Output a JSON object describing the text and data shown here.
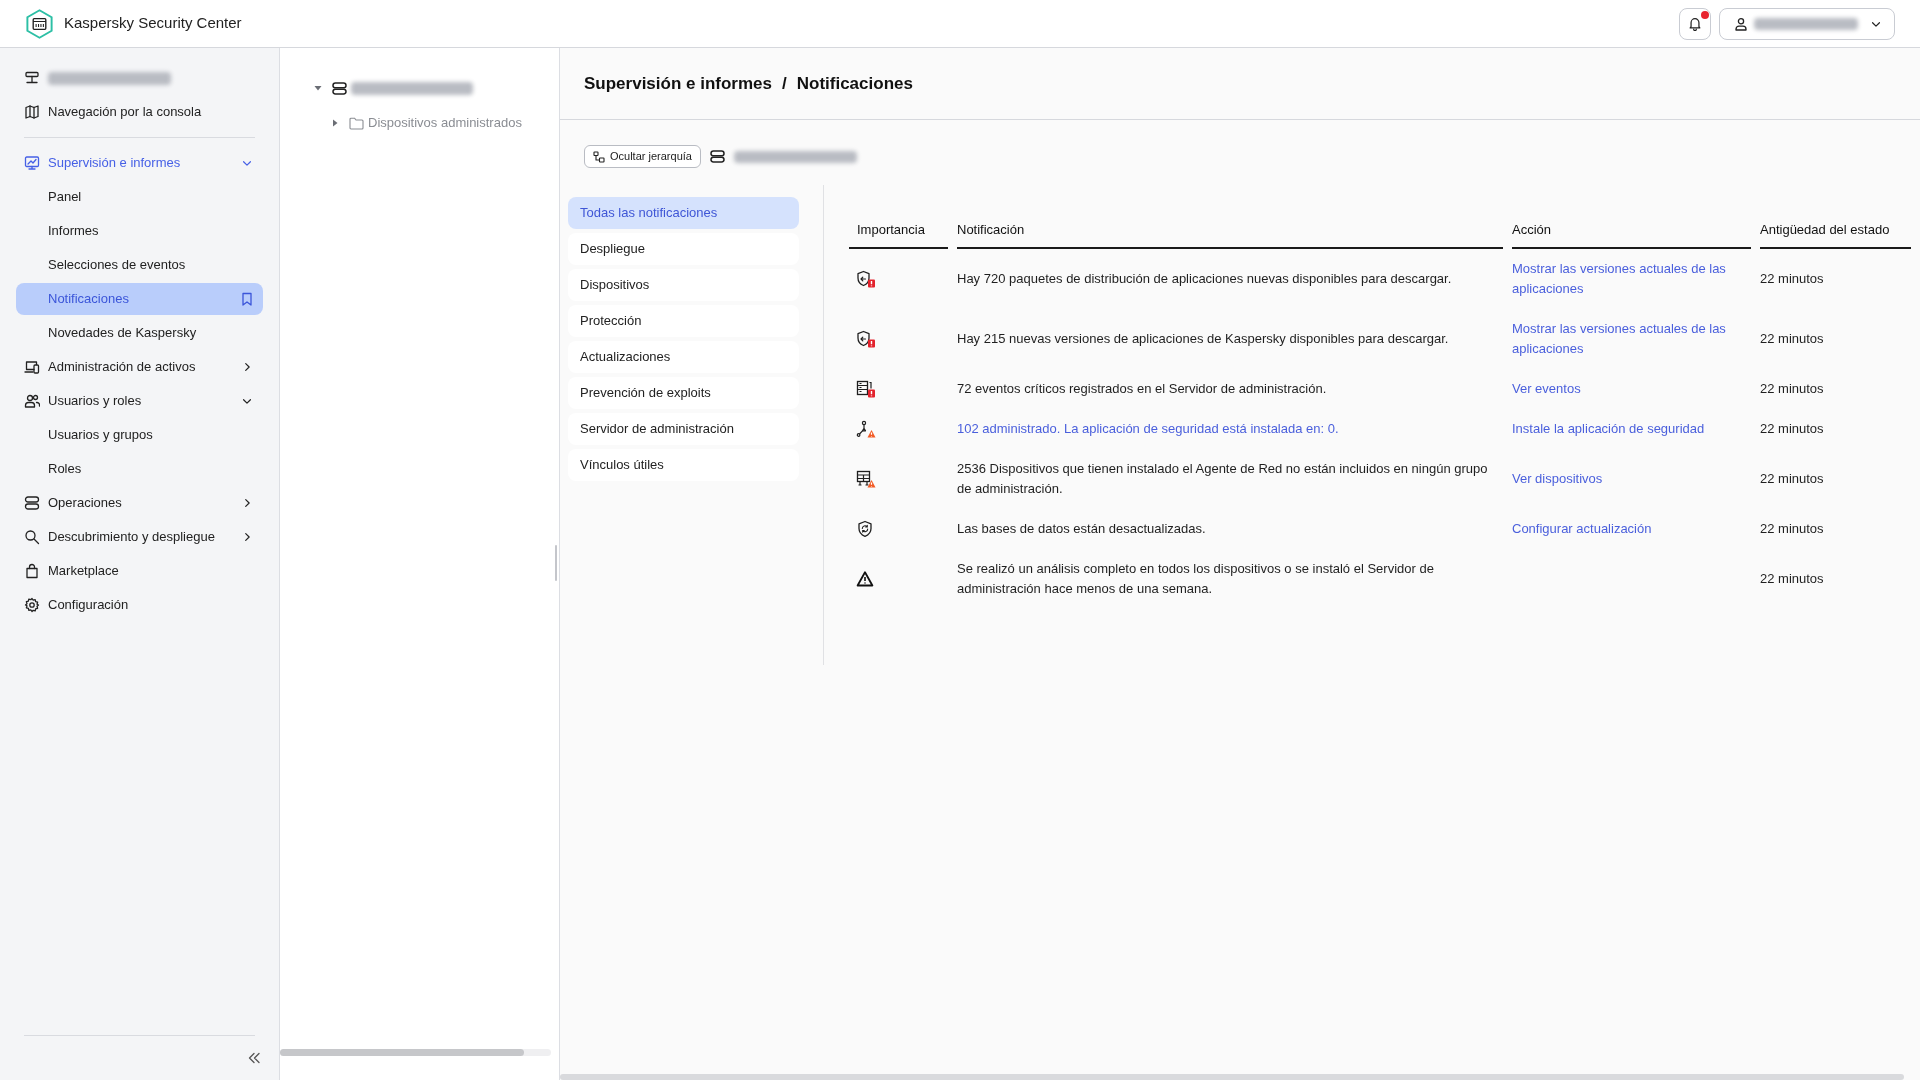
{
  "header": {
    "title": "Kaspersky Security Center",
    "notifications": {
      "unread": true
    },
    "user": {
      "redacted": true
    }
  },
  "sidebar": {
    "top_items": [
      {
        "kind": "server",
        "redacted": true,
        "selected": false
      },
      {
        "kind": "map",
        "label": "Navegación por la consola",
        "selected": false
      }
    ],
    "items": [
      {
        "kind": "monitoring",
        "label": "Supervisión e informes",
        "selected": false,
        "expanded": true,
        "children": [
          {
            "label": "Panel",
            "selected": false
          },
          {
            "label": "Informes",
            "selected": false
          },
          {
            "label": "Selecciones de eventos",
            "selected": false
          },
          {
            "label": "Notificaciones",
            "selected": true
          },
          {
            "label": "Novedades de Kaspersky",
            "selected": false
          }
        ]
      },
      {
        "kind": "assets",
        "label": "Administración de activos",
        "selected": false,
        "expanded": false
      },
      {
        "kind": "users",
        "label": "Usuarios y roles",
        "selected": false,
        "expanded": true,
        "children": [
          {
            "label": "Usuarios y grupos",
            "selected": false
          },
          {
            "label": "Roles",
            "selected": false
          }
        ]
      },
      {
        "kind": "operations",
        "label": "Operaciones",
        "selected": false,
        "expanded": false
      },
      {
        "kind": "discovery",
        "label": "Descubrimiento y despliegue",
        "selected": false,
        "expanded": false
      },
      {
        "kind": "marketplace",
        "label": "Marketplace",
        "selected": false
      },
      {
        "kind": "settings",
        "label": "Configuración",
        "selected": false
      }
    ]
  },
  "tree": {
    "nodes": [
      {
        "kind": "server",
        "redacted": true,
        "expanded": true,
        "selected": false,
        "children": [
          {
            "kind": "folder",
            "label": "Dispositivos administrados",
            "expanded": false,
            "selected": false
          }
        ]
      }
    ]
  },
  "main": {
    "breadcrumb": [
      "Supervisión e informes",
      "Notificaciones"
    ],
    "separator": "/",
    "toolbar": {
      "button": "Ocultar jerarquía",
      "server": {
        "redacted": true
      }
    },
    "categories": [
      {
        "label": "Todas las notificaciones",
        "selected": true
      },
      {
        "label": "Despliegue",
        "selected": false
      },
      {
        "label": "Dispositivos",
        "selected": false
      },
      {
        "label": "Protección",
        "selected": false
      },
      {
        "label": "Actualizaciones",
        "selected": false
      },
      {
        "label": "Prevención de exploits",
        "selected": false
      },
      {
        "label": "Servidor de administración",
        "selected": false
      },
      {
        "label": "Vínculos útiles",
        "selected": false
      }
    ],
    "table": {
      "columns": [
        "Importancia",
        "Notificación",
        "Acción",
        "Antigüedad del estado"
      ],
      "rows": [
        {
          "kind": "update",
          "critical": true,
          "warning": false,
          "notification": {
            "text": "Hay 720 paquetes de distribución de aplicaciones nuevas disponibles para descargar.",
            "link": false
          },
          "action": "Mostrar las versiones actuales de las aplicaciones",
          "age": "22 minutos"
        },
        {
          "kind": "update",
          "critical": true,
          "warning": false,
          "notification": {
            "text": "Hay 215 nuevas versiones de aplicaciones de Kaspersky disponibles para descargar.",
            "link": false
          },
          "action": "Mostrar las versiones actuales de las aplicaciones",
          "age": "22 minutos"
        },
        {
          "kind": "events",
          "critical": true,
          "warning": false,
          "notification": {
            "text": "72 eventos críticos registrados en el Servidor de administración.",
            "link": false
          },
          "action": "Ver eventos",
          "age": "22 minutos"
        },
        {
          "kind": "deployment",
          "critical": false,
          "warning": true,
          "notification": {
            "text": "102 administrado. La aplicación de seguridad está instalada en: 0.",
            "link": true
          },
          "action": "Instale la aplicación de seguridad",
          "age": "22 minutos"
        },
        {
          "kind": "devices",
          "critical": false,
          "warning": true,
          "notification": {
            "text": "2536 Dispositivos que tienen instalado el Agente de Red no están incluidos en ningún grupo de administración.",
            "link": false
          },
          "action": "Ver dispositivos",
          "age": "22 minutos"
        },
        {
          "kind": "databases",
          "critical": false,
          "warning": false,
          "notification": {
            "text": "Las bases de datos están desactualizadas.",
            "link": false
          },
          "action": "Configurar actualización",
          "age": "22 minutos"
        },
        {
          "kind": "scan",
          "critical": false,
          "warning": false,
          "notification": {
            "text": "Se realizó un análisis completo en todos los dispositivos o se instaló el Servidor de administración hace menos de una semana.",
            "link": false
          },
          "age": "22 minutos"
        }
      ]
    }
  }
}
